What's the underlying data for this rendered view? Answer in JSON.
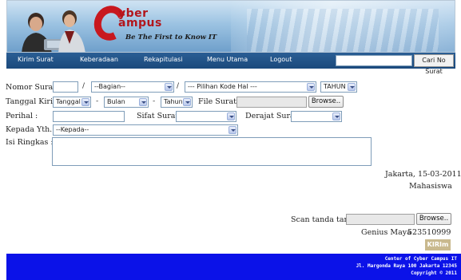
{
  "banner": {
    "logo_top": "yber",
    "logo_bottom": "ampus",
    "tagline": "Be The First to Know IT"
  },
  "nav": {
    "items": [
      "Kirim Surat",
      "Keberadaan",
      "Rekapitulasi",
      "Menu Utama",
      "Logout"
    ],
    "search_value": "",
    "search_button": "Cari No Surat"
  },
  "form": {
    "nomor_surat": {
      "label": "Nomor Surat :",
      "number_value": "",
      "bagian": "--Bagian--",
      "kode_hal": "--- Pilihan Kode Hal ---",
      "tahun": "TAHUN",
      "separator": "/"
    },
    "tanggal_kirim": {
      "label": "Tanggal Kirim :",
      "tanggal": "Tanggal",
      "bulan": "Bulan",
      "tahun": "Tahun",
      "dash": "-",
      "file_label": "File Surat :",
      "browse": "Browse.."
    },
    "perihal": {
      "label": "Perihal :",
      "value": "",
      "sifat_label": "Sifat Surat :",
      "sifat_value": "",
      "derajat_label": "Derajat Surat",
      "derajat_value": ""
    },
    "kepada": {
      "label": "Kepada Yth. :",
      "value": "--Kepada--"
    },
    "isi": {
      "label": "Isi Ringkas :",
      "value": ""
    }
  },
  "signature": {
    "place_date": "Jakarta, 15-03-2011",
    "role": "Mahasiswa",
    "scan_label": "Scan tanda tangan",
    "browse": "Browse..",
    "name": "Genius Maya",
    "nim": "523510999",
    "submit": "KIRIm"
  },
  "footer": {
    "line1": "Center of Cyber Campus IT",
    "line2": "Jl. Margonda Raya 100 Jakarta 12345",
    "line3": "Copyright © 2011"
  },
  "colors": {
    "nav_bg": "#1b4a7c",
    "footer_bg": "#0b12e8",
    "logo_red": "#c8181f",
    "submit_bg": "#c9b98e"
  }
}
